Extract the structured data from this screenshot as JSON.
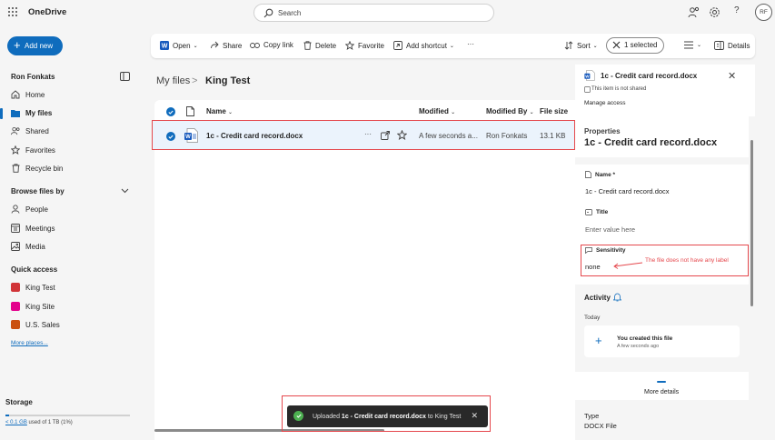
{
  "app": {
    "name": "OneDrive"
  },
  "search": {
    "placeholder": "Search"
  },
  "user": {
    "name": "Ron Fonkats",
    "initials": "RF"
  },
  "addnew": {
    "label": "Add new"
  },
  "nav": {
    "items": [
      {
        "label": "Home",
        "icon": "home-icon"
      },
      {
        "label": "My files",
        "icon": "folder-icon",
        "active": true
      },
      {
        "label": "Shared",
        "icon": "people-icon"
      },
      {
        "label": "Favorites",
        "icon": "star-icon"
      },
      {
        "label": "Recycle bin",
        "icon": "trash-icon"
      }
    ],
    "browse_title": "Browse files by",
    "browse_items": [
      {
        "label": "People",
        "icon": "person-icon"
      },
      {
        "label": "Meetings",
        "icon": "calendar-icon"
      },
      {
        "label": "Media",
        "icon": "image-icon"
      }
    ],
    "quick_title": "Quick access",
    "quick_items": [
      {
        "label": "King Test",
        "color": "#d13438"
      },
      {
        "label": "King Site",
        "color": "#e3008c"
      },
      {
        "label": "U.S. Sales",
        "color": "#ca5010"
      }
    ],
    "more_places": "More places..."
  },
  "storage": {
    "title": "Storage",
    "used": "< 0.1 GB",
    "rest": " used of 1 TB (1%)",
    "fraction": 0.01
  },
  "commands": {
    "open": "Open",
    "share": "Share",
    "copy_link": "Copy link",
    "delete": "Delete",
    "favorite": "Favorite",
    "add_shortcut": "Add shortcut",
    "more": "···",
    "sort": "Sort",
    "selected": "1 selected",
    "details": "Details"
  },
  "breadcrumb": {
    "root": "My files",
    "sep": ">",
    "current": "King Test"
  },
  "table": {
    "headers": {
      "name": "Name",
      "modified": "Modified",
      "modified_by": "Modified By",
      "size": "File size"
    },
    "rows": [
      {
        "name": "1c - Credit card record.docx",
        "more": "···",
        "modified": "A few seconds a...",
        "modified_by": "Ron Fonkats",
        "size": "13.1 KB"
      }
    ]
  },
  "toast": {
    "prefix": "Uploaded ",
    "file": "1c - Credit card record.docx",
    "suffix": " to King Test"
  },
  "pane": {
    "file": "1c - Credit card record.docx",
    "not_shared": "This item is not shared",
    "manage_access": "Manage access",
    "properties_label": "Properties",
    "properties_title": "1c - Credit card record.docx",
    "name_label": "Name *",
    "name_value": "1c - Credit card record.docx",
    "title_label": "Title",
    "title_placeholder": "Enter value here",
    "sensitivity_label": "Sensitivity",
    "sensitivity_value": "none",
    "annotation": "The file does not have any label",
    "activity_title": "Activity",
    "today": "Today",
    "activity_text": "You created this file",
    "activity_time": "A few seconds ago",
    "more_details": "More details",
    "type_label": "Type",
    "type_value": "DOCX File"
  },
  "colors": {
    "accent": "#0f6cbd",
    "annotation": "#e5484d",
    "toast_bg": "#292929",
    "success": "#4caf50"
  }
}
